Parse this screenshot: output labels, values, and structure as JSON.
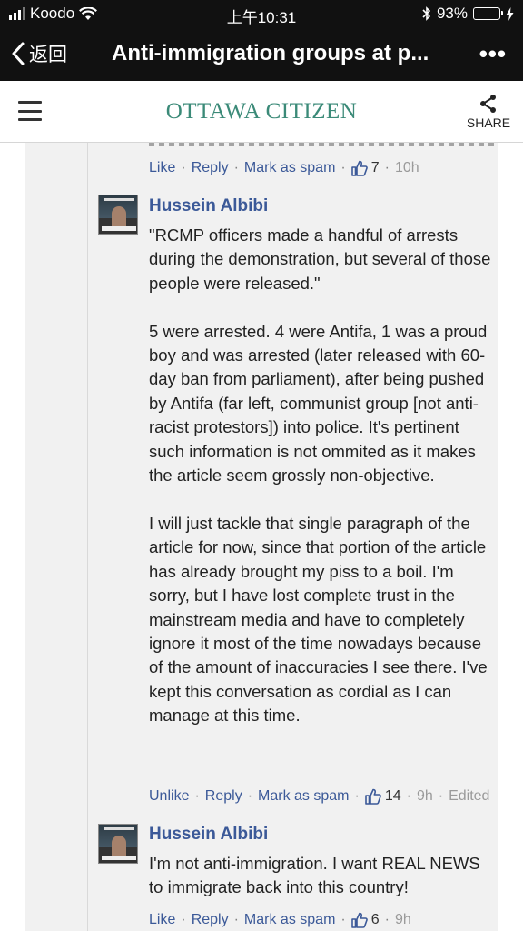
{
  "status_bar": {
    "carrier": "Koodo",
    "time": "上午10:31",
    "battery": "93%"
  },
  "nav": {
    "back_label": "返回",
    "title": "Anti-immigration groups at p...",
    "more": "•••"
  },
  "site_header": {
    "logo": "OTTAWA CITIZEN",
    "share_label": "SHARE"
  },
  "comments": [
    {
      "like_label": "Like",
      "reply_label": "Reply",
      "spam_label": "Mark as spam",
      "likes": "7",
      "age": "10h"
    },
    {
      "author": "Hussein Albibi",
      "text": "\"RCMP officers made a handful of arrests during the demonstration, but several of those people were released.\"\n\n5 were arrested. 4 were Antifa, 1 was a proud boy and was arrested (later released with 60-day ban from parliament), after being pushed by Antifa (far left, communist group [not anti-racist protestors]) into police. It's pertinent such information is not ommited as it makes the article seem grossly non-objective.\n\nI will just tackle that single paragraph of the article for now, since that portion of the article has already brought my piss to a boil. I'm sorry, but I have lost complete trust in the mainstream media and have to completely ignore it most of the time nowadays because of the amount of inaccuracies I see there. I've kept this conversation as cordial as I can manage at this time.",
      "like_label": "Unlike",
      "reply_label": "Reply",
      "spam_label": "Mark as spam",
      "likes": "14",
      "age": "9h",
      "edited": "Edited"
    },
    {
      "author": "Hussein Albibi",
      "text": "I'm not anti-immigration. I want REAL NEWS to immigrate back into this country!",
      "like_label": "Like",
      "reply_label": "Reply",
      "spam_label": "Mark as spam",
      "likes": "6",
      "age": "9h"
    }
  ],
  "colors": {
    "link": "#3b5998",
    "logo": "#3b8a78",
    "battery": "#39d353"
  }
}
